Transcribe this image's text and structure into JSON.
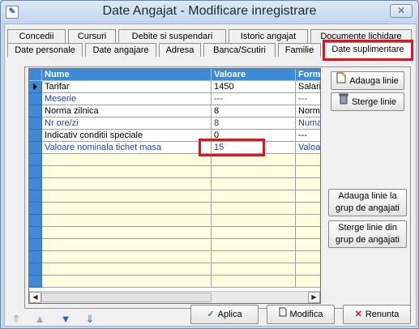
{
  "window": {
    "title": "Date Angajat - Modificare inregistrare",
    "close_glyph": "✕"
  },
  "tabs_row1": [
    "Concedii",
    "Cursuri",
    "Debite si suspendari",
    "Istoric angajat",
    "Documente lichidare"
  ],
  "tabs_row2": [
    "Date personale",
    "Date angajare",
    "Adresa",
    "Banca/Scutiri",
    "Familie",
    "Date suplimentare"
  ],
  "grid": {
    "columns": [
      "Nume",
      "Valoare",
      "Formula"
    ],
    "rows": [
      {
        "name": "Tarifar",
        "value": "1450",
        "formula": "Salariu",
        "blue": false
      },
      {
        "name": "Meserie",
        "value": "---",
        "formula": "---",
        "blue": true
      },
      {
        "name": "Norma zilnica",
        "value": "8",
        "formula": "Norma",
        "blue": false
      },
      {
        "name": "Nr ore/zi",
        "value": "8",
        "formula": "Numar",
        "blue": true
      },
      {
        "name": "Indicativ conditii speciale",
        "value": "0",
        "formula": "---",
        "blue": false
      },
      {
        "name": "Valoare nominala tichet masa",
        "value": "15",
        "formula": "Valoare",
        "blue": true
      }
    ],
    "empty_rows": 11
  },
  "side_buttons": {
    "add_line": "Adauga linie",
    "delete_line": "Sterge linie",
    "add_group": "Adauga linie la grup de angajati",
    "delete_group": "Sterge linie din grup de angajati"
  },
  "bottom_buttons": {
    "apply": "Aplica",
    "modify": "Modifica",
    "cancel": "Renunta"
  },
  "colors": {
    "header_blue": "#3e8ad6",
    "highlight_red": "#e8121a",
    "empty_row": "#ffffe1"
  }
}
